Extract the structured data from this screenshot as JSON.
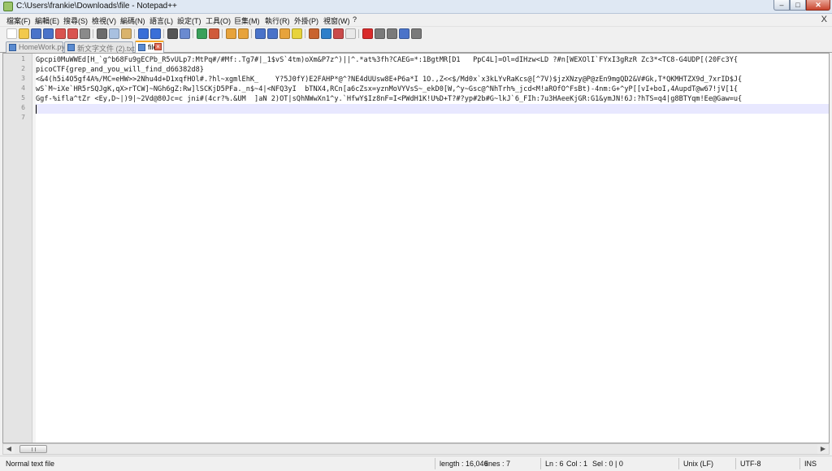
{
  "window": {
    "title": "C:\\Users\\frankie\\Downloads\\file - Notepad++",
    "minimize_glyph": "–",
    "maximize_glyph": "□",
    "close_glyph": "✕"
  },
  "menu": {
    "items": [
      "檔案(F)",
      "編輯(E)",
      "搜尋(S)",
      "檢視(V)",
      "編碼(N)",
      "語言(L)",
      "設定(T)",
      "工具(O)",
      "巨集(M)",
      "執行(R)",
      "外掛(P)",
      "視窗(W)",
      "?"
    ],
    "close_glyph": "X"
  },
  "toolbar": {
    "buttons": [
      {
        "icon": "new-file-icon",
        "color": "#ffffff"
      },
      {
        "icon": "open-file-icon",
        "color": "#f2c94c"
      },
      {
        "icon": "save-icon",
        "color": "#4a73c9"
      },
      {
        "icon": "save-all-icon",
        "color": "#4a73c9"
      },
      {
        "icon": "close-icon",
        "color": "#d9534f"
      },
      {
        "icon": "close-all-icon",
        "color": "#d9534f"
      },
      {
        "icon": "print-icon",
        "color": "#8a8a8a"
      },
      {
        "icon": "cut-icon",
        "color": "#6b6b6b"
      },
      {
        "icon": "copy-icon",
        "color": "#a8c0e0"
      },
      {
        "icon": "paste-icon",
        "color": "#d9b36c"
      },
      {
        "icon": "undo-icon",
        "color": "#3a6fd8"
      },
      {
        "icon": "redo-icon",
        "color": "#3a6fd8"
      },
      {
        "icon": "find-icon",
        "color": "#555555"
      },
      {
        "icon": "replace-icon",
        "color": "#6a8ad0"
      },
      {
        "icon": "zoom-in-icon",
        "color": "#3aa05a"
      },
      {
        "icon": "zoom-out-icon",
        "color": "#d05a3a"
      },
      {
        "icon": "sync-vertical-icon",
        "color": "#e7a33b"
      },
      {
        "icon": "sync-horizontal-icon",
        "color": "#e7a33b"
      },
      {
        "icon": "word-wrap-icon",
        "color": "#4a73c9"
      },
      {
        "icon": "show-all-chars-icon",
        "color": "#4a73c9"
      },
      {
        "icon": "indent-guide-icon",
        "color": "#e7a33b"
      },
      {
        "icon": "language-icon",
        "color": "#e7d33b"
      },
      {
        "icon": "doc-map-icon",
        "color": "#c9642e"
      },
      {
        "icon": "function-list-icon",
        "color": "#2e7fc9"
      },
      {
        "icon": "folder-workspace-icon",
        "color": "#c94a4a"
      },
      {
        "icon": "monitor-icon",
        "color": "#e8e8e8"
      },
      {
        "icon": "record-macro-icon",
        "color": "#d92b2b"
      },
      {
        "icon": "stop-macro-icon",
        "color": "#7a7a7a"
      },
      {
        "icon": "play-macro-icon",
        "color": "#7a7a7a"
      },
      {
        "icon": "play-multiple-icon",
        "color": "#4a73c9"
      },
      {
        "icon": "save-macro-icon",
        "color": "#7a7a7a"
      }
    ]
  },
  "tabs": [
    {
      "label": "HomeWork.py",
      "active": false
    },
    {
      "label": "新文字文件 (2).txt",
      "active": false
    },
    {
      "label": "file",
      "active": true
    }
  ],
  "editor": {
    "line_numbers": [
      "1",
      "2",
      "3",
      "4",
      "5",
      "6",
      "7"
    ],
    "lines": [
      "Gpcpi0MuWWEd[H_`g^b68Fu9gECPb_R5vULp7:MtPq#/#Mf:.Tg7#|_1$vS`4tm)oXm&P7z^)||^.*at%3fh?CAEG=*:1BgtMR[D1   PpC4L]=Ol=dIHzw<LD ?#n[WEXOlI`FYxI3gRzR Zc3*<TC8-G4UDP[(20Fc3Y{",
      "picoCTF{grep_and_you_will_find_d66382d8}",
      "<&4(h5i4O5gf4A%/MC=eHW>>2Nhu4d+D1xqfHOl#.?hl~xgmlEhK_    Y?5J0fY)E2FAHP*@^?NE4dUUsw8E+P6a*I 1O.,Z<<$/Md0x`x3kLYvRaKcs@[^7V)$jzXNzy@P@zEn9mgQD2&V#Gk,T*QKMHTZX9d_7xrID$J{",
      "wS`M~iXe`HR5rSQJgK,qX>rTCW]~NGh6gZ:Rw]lSCKjD5PFa._n$~4|<NFQ3yI  bTNX4,RCn[a6cZsx=yznMoVYVsS~_ekD0[W,^y~Gsc@^NhTrh%_jcd<M!aROfO^FsBt)-4nm:G+^yP[[vI+boI,4AupdT@w67!jV[1{",
      "Ggf-%ifla^tZr <Ey,D~|)9|~2Vd@80Jc=c jni#(4cr?%.&UM  ]aN 2)OT|sQhNWwXn1^y.`HfwY$Iz8nF=I<PWdH1K!U%D+T?#?yp#2b#G~lkJ`6_FIh:7u3HAeeKjGR:G1&ymJN!6J:?hTS=q4|g8BTYqm!Ee@Gaw=u{",
      "",
      ""
    ],
    "current_line": 6
  },
  "status": {
    "file_type": "Normal text file",
    "length": "length : 16,046",
    "lines": "lines : 7",
    "ln": "Ln : 6",
    "col": "Col : 1",
    "sel": "Sel : 0 | 0",
    "eol": "Unix (LF)",
    "encoding": "UTF-8",
    "mode": "INS"
  }
}
